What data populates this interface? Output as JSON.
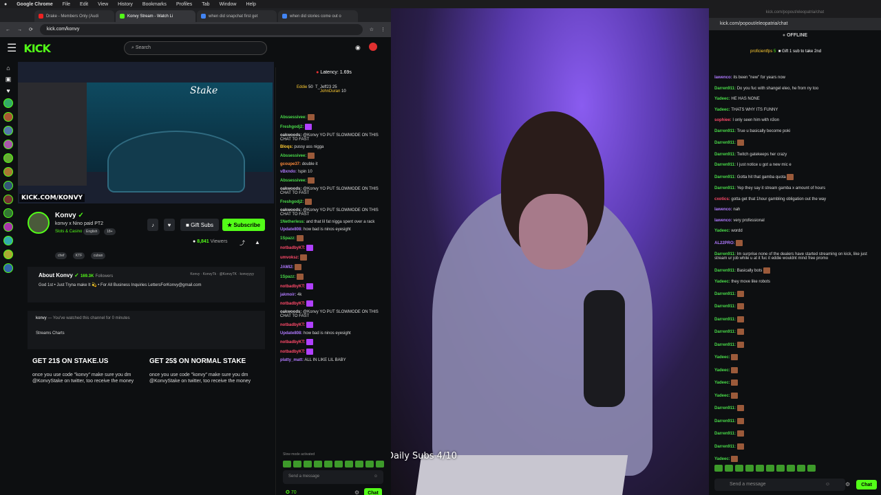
{
  "menubar": {
    "app": "Google Chrome",
    "items": [
      "File",
      "Edit",
      "View",
      "History",
      "Bookmarks",
      "Profiles",
      "Tab",
      "Window",
      "Help"
    ]
  },
  "tabs": [
    {
      "label": "Drake - Members Only (Audi",
      "color": "#e22"
    },
    {
      "label": "Konvy Stream - Watch Li",
      "color": "#53fc18"
    },
    {
      "label": "when did snapchat first get",
      "color": "#4285f4"
    },
    {
      "label": "when did stories come out o",
      "color": "#4285f4"
    }
  ],
  "url": "kick.com/konvy",
  "kick": {
    "logo": "KICK",
    "search_placeholder": "Search"
  },
  "player": {
    "watermark": "KICK.COM/KONVY",
    "site_name": "Stake"
  },
  "channel": {
    "name": "Konvy",
    "title": "konvy x Nino paid PT2",
    "category": "Slots & Casino",
    "lang": "English",
    "age": "18+",
    "tags": [
      "chef",
      "KTF",
      "cuban"
    ],
    "gift": "Gift Subs",
    "subscribe": "Subscribe",
    "viewers": "8,841",
    "viewers_label": "Viewers"
  },
  "about": {
    "heading": "About Konvy",
    "followers": "169.3K",
    "followers_label": "Followers",
    "bio": "God 1st • Just Tryna make It 💫 • For All Business Inquiries LettersForKonvy@gmail.com",
    "socials": [
      "Konvy",
      "KonvyTk",
      "@KonvyTK",
      "konvyyyy"
    ]
  },
  "watched": {
    "user": "konvy",
    "text": "You've watched this channel for 0 minutes",
    "charts": "Streams Charts"
  },
  "panels": [
    {
      "heading": "GET 21$ ON STAKE.US",
      "text": "once you use code \"konvy\" make sure you dm @KonvyStake on twitter, too receive the money"
    },
    {
      "heading": "GET 25$ ON NORMAL STAKE",
      "text": "once you use code \"konvy\" make sure you dm @KonvyStake on twitter, too receive the money"
    }
  ],
  "chat1": {
    "latency": "Latency: 1.69s",
    "top": {
      "a": "Eddie",
      "a_n": "50",
      "b": "T_Jeff23",
      "b_n": "25",
      "c": "JohnDuran",
      "c_n": "10"
    },
    "messages": [
      {
        "u": "Abssessivee:",
        "c": "#4ade4a",
        "t": "",
        "e": "b"
      },
      {
        "u": "Freshgodj2:",
        "c": "#4ade4a",
        "t": "",
        "e": "p"
      },
      {
        "u": "oakwoods:",
        "c": "#ddd",
        "t": "@Konvy YO PUT SLOWMODE ON THIS CHAT TO FAST",
        "e": ""
      },
      {
        "u": "Bloqs:",
        "c": "#ffcc33",
        "t": "pussy ass nigga",
        "e": ""
      },
      {
        "u": "Abssessivee:",
        "c": "#4ade4a",
        "t": "",
        "e": "b"
      },
      {
        "u": "gcoupe37:",
        "c": "#ff8a3a",
        "t": "double it",
        "e": ""
      },
      {
        "u": "vBxndo:",
        "c": "#b07aff",
        "t": "!spin 10",
        "e": ""
      },
      {
        "u": "Abssessivee:",
        "c": "#4ade4a",
        "t": "",
        "e": "b"
      },
      {
        "u": "oakwoods:",
        "c": "#ddd",
        "t": "@Konvy YO PUT SLOWMODE ON THIS CHAT TO FAST",
        "e": ""
      },
      {
        "u": "Freshgodj2:",
        "c": "#4ade4a",
        "t": "",
        "e": "b"
      },
      {
        "u": "oakwoods:",
        "c": "#ddd",
        "t": "@Konvy YO PUT SLOWMODE ON THIS CHAT TO FAST",
        "e": ""
      },
      {
        "u": "1Netherless:",
        "c": "#4ade4a",
        "t": "and that lil fat nigga spent over a rack",
        "e": ""
      },
      {
        "u": "Update808:",
        "c": "#b07aff",
        "t": "how bad is ninos eyesight",
        "e": ""
      },
      {
        "u": "1Spazz:",
        "c": "#4ade4a",
        "t": "",
        "e": "b"
      },
      {
        "u": "notbadbyKT:",
        "c": "#ff4a6a",
        "t": "",
        "e": "p"
      },
      {
        "u": "umvoksz:",
        "c": "#ff4a6a",
        "t": "",
        "e": "b"
      },
      {
        "u": "JAMI2:",
        "c": "#b07aff",
        "t": "",
        "e": "b"
      },
      {
        "u": "1Spazz:",
        "c": "#4ade4a",
        "t": "",
        "e": "b"
      },
      {
        "u": "notbadbyKT:",
        "c": "#ff4a6a",
        "t": "",
        "e": "p"
      },
      {
        "u": "jakmoir:",
        "c": "#b07aff",
        "t": "4k",
        "e": ""
      },
      {
        "u": "notbadbyKT:",
        "c": "#ff4a6a",
        "t": "",
        "e": "p"
      },
      {
        "u": "oakwoods:",
        "c": "#ddd",
        "t": "@Konvy YO PUT SLOWMODE ON THIS CHAT TO FAST",
        "e": ""
      },
      {
        "u": "notbadbyKT:",
        "c": "#ff4a6a",
        "t": "",
        "e": "p"
      },
      {
        "u": "Update808:",
        "c": "#b07aff",
        "t": "how bad is ninos eyesight",
        "e": ""
      },
      {
        "u": "notbadbyKT:",
        "c": "#ff4a6a",
        "t": "",
        "e": "p"
      },
      {
        "u": "notbadbyKT:",
        "c": "#ff4a6a",
        "t": "",
        "e": "p"
      },
      {
        "u": "platty_matt:",
        "c": "#b07aff",
        "t": "ALL IN LIKE LIL BABY",
        "e": ""
      }
    ],
    "slow": "Slow mode activated",
    "placeholder": "Send a message",
    "points": "70",
    "chat_btn": "Chat"
  },
  "overlay": {
    "subs": "Daily Subs 4/10"
  },
  "chat2": {
    "titlebar": "kick.com/popout/eleopatria/chat",
    "url": "kick.com/popout/eleopatria/chat",
    "offline": "OFFLINE",
    "gift_user": "proficientfps",
    "gift_n": "5",
    "gift_text": "Gift 1 sub to take 2nd",
    "messages": [
      {
        "u": "lawenco:",
        "c": "#b07aff",
        "t": "its been \"new\" for years now",
        "e": ""
      },
      {
        "u": "Darren911:",
        "c": "#4ade4a",
        "t": "Do you fuc with shangel eleo, he from ny too",
        "e": ""
      },
      {
        "u": "Yadeec:",
        "c": "#4ade4a",
        "t": "HE HAS NONE",
        "e": ""
      },
      {
        "u": "Yadeec:",
        "c": "#4ade4a",
        "t": "THATS WHY ITS FUNNY",
        "e": ""
      },
      {
        "u": "sophiee:",
        "c": "#ff4a6a",
        "t": "I only seen him with n3on",
        "e": ""
      },
      {
        "u": "Darren911:",
        "c": "#4ade4a",
        "t": "True u basically become poki",
        "e": ""
      },
      {
        "u": "Darren911:",
        "c": "#4ade4a",
        "t": "",
        "e": "b"
      },
      {
        "u": "Darren911:",
        "c": "#4ade4a",
        "t": "Twitch gatekeeps her crazy",
        "e": ""
      },
      {
        "u": "Darren911:",
        "c": "#4ade4a",
        "t": "I just notice u got a new mic e",
        "e": ""
      },
      {
        "u": "Darren911:",
        "c": "#4ade4a",
        "t": "Gotta hit that gamba quota",
        "e": "b"
      },
      {
        "u": "Darren911:",
        "c": "#4ade4a",
        "t": "Yep they say it stream gamba x amount of hours",
        "e": ""
      },
      {
        "u": "cxotics:",
        "c": "#ff4a6a",
        "t": "gotta get that 1hour gambling obligation out the way",
        "e": ""
      },
      {
        "u": "lawenco:",
        "c": "#b07aff",
        "t": "nah",
        "e": ""
      },
      {
        "u": "lawenco:",
        "c": "#b07aff",
        "t": "very professional",
        "e": ""
      },
      {
        "u": "Yadeec:",
        "c": "#4ade4a",
        "t": "wordd",
        "e": ""
      },
      {
        "u": "AL22PRO:",
        "c": "#b07aff",
        "t": "",
        "e": "b"
      },
      {
        "u": "Darren911:",
        "c": "#4ade4a",
        "t": "Im surprise none of the dealers have started streaming on kick, like just stream ur job while u at it fuc it eddie wouldnt mind free promo",
        "e": ""
      },
      {
        "u": "Darren911:",
        "c": "#4ade4a",
        "t": "Basically bots",
        "e": "b"
      },
      {
        "u": "Yadeec:",
        "c": "#4ade4a",
        "t": "they move like robots",
        "e": ""
      },
      {
        "u": "Darren911:",
        "c": "#4ade4a",
        "t": "",
        "e": "b"
      },
      {
        "u": "Darren911:",
        "c": "#4ade4a",
        "t": "",
        "e": "b"
      },
      {
        "u": "Darren911:",
        "c": "#4ade4a",
        "t": "",
        "e": "b"
      },
      {
        "u": "Darren911:",
        "c": "#4ade4a",
        "t": "",
        "e": "b"
      },
      {
        "u": "Darren911:",
        "c": "#4ade4a",
        "t": "",
        "e": "b"
      },
      {
        "u": "Yadeec:",
        "c": "#4ade4a",
        "t": "",
        "e": "b"
      },
      {
        "u": "Yadeec:",
        "c": "#4ade4a",
        "t": "",
        "e": "b"
      },
      {
        "u": "Yadeec:",
        "c": "#4ade4a",
        "t": "",
        "e": "b"
      },
      {
        "u": "Yadeec:",
        "c": "#4ade4a",
        "t": "",
        "e": "b"
      },
      {
        "u": "Darren911:",
        "c": "#4ade4a",
        "t": "",
        "e": "b"
      },
      {
        "u": "Darren911:",
        "c": "#4ade4a",
        "t": "",
        "e": "b"
      },
      {
        "u": "Darren911:",
        "c": "#4ade4a",
        "t": "",
        "e": "b"
      },
      {
        "u": "Darren911:",
        "c": "#4ade4a",
        "t": "",
        "e": "b"
      },
      {
        "u": "Yadeec:",
        "c": "#4ade4a",
        "t": "",
        "e": "b"
      }
    ],
    "placeholder": "Send a message",
    "chat_btn": "Chat"
  }
}
